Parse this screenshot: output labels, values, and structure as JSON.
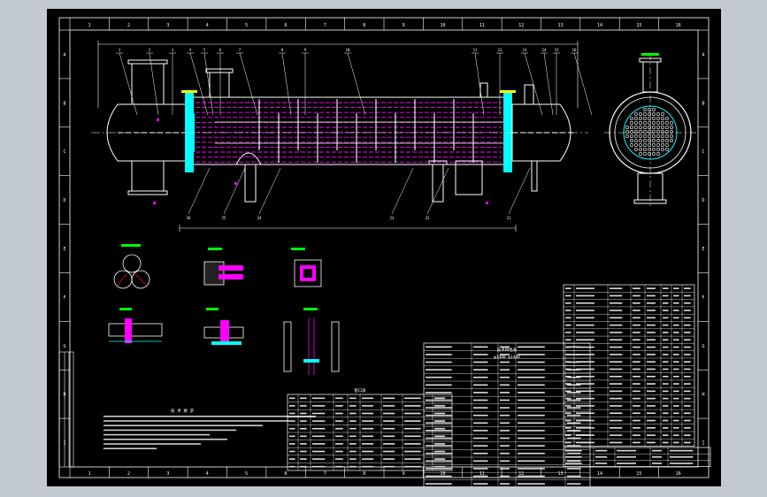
{
  "colors": {
    "background": "#c3c9d0",
    "canvas": "#000000",
    "line": "#ffffff",
    "tubes": "#ff00ff",
    "plates": "#00ffff",
    "accent": "#ffff00",
    "dims": "#00ff00"
  },
  "frame": {
    "top_numbers": [
      "1",
      "2",
      "3",
      "4",
      "5",
      "6",
      "7",
      "8",
      "9",
      "10",
      "11",
      "12",
      "13",
      "14",
      "15",
      "16"
    ],
    "bottom_numbers": [
      "1",
      "2",
      "3",
      "4",
      "5",
      "6",
      "7",
      "8",
      "9",
      "10",
      "11",
      "12",
      "13",
      "14",
      "15",
      "16"
    ],
    "left_letters": [
      "A",
      "B",
      "C",
      "D",
      "E",
      "F",
      "G",
      "H",
      "I"
    ],
    "right_letters": [
      "A",
      "B",
      "C",
      "D",
      "E",
      "F",
      "G",
      "H",
      "I"
    ]
  },
  "leaders": {
    "top": [
      "1",
      "2",
      "3",
      "4",
      "5",
      "6",
      "7",
      "8",
      "9",
      "10",
      "11",
      "12",
      "13",
      "14",
      "15",
      "16"
    ],
    "bottom": [
      "26",
      "25",
      "24",
      "23",
      "22",
      "21"
    ]
  },
  "notes_title": "技 术 要 求",
  "tables": {
    "nozzle_title": "管口表",
    "spec_title": "技术特性表",
    "spec_row": "φ1400 φ1400"
  }
}
